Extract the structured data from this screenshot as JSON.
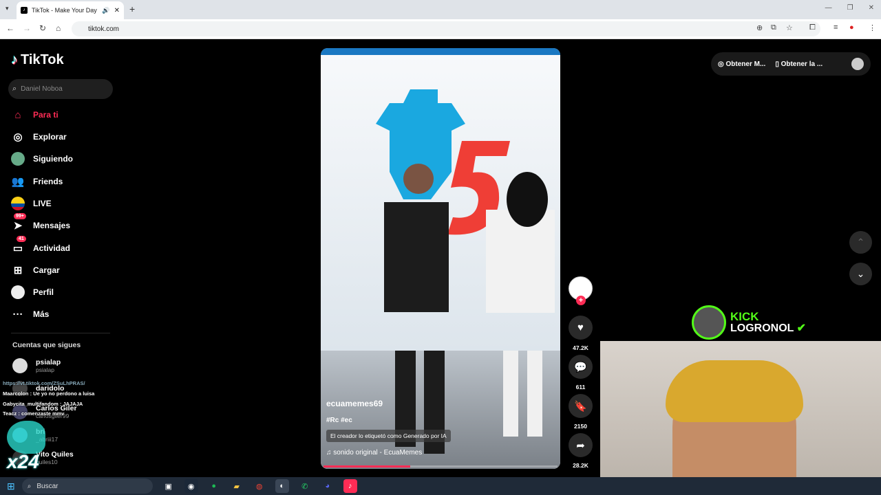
{
  "browser": {
    "tab_title": "TikTok - Make Your Day",
    "url": "tiktok.com"
  },
  "tiktok": {
    "logo": "TikTok",
    "search_placeholder": "Daniel Noboa",
    "nav": [
      {
        "label": "Para ti",
        "icon": "home-icon",
        "active": true
      },
      {
        "label": "Explorar",
        "icon": "compass-icon"
      },
      {
        "label": "Siguiendo",
        "icon": "avatar-icon"
      },
      {
        "label": "Friends",
        "icon": "people-icon"
      },
      {
        "label": "LIVE",
        "icon": "live-icon"
      },
      {
        "label": "Mensajes",
        "icon": "send-icon",
        "badge": "99+"
      },
      {
        "label": "Actividad",
        "icon": "inbox-icon",
        "badge": "41"
      },
      {
        "label": "Cargar",
        "icon": "plus-square-icon"
      },
      {
        "label": "Perfil",
        "icon": "profile-icon"
      },
      {
        "label": "Más",
        "icon": "more-icon"
      }
    ],
    "following_title": "Cuentas que sigues",
    "following": [
      {
        "name": "psialap",
        "user": "psialap"
      },
      {
        "name": "daridolo",
        "user": ""
      },
      {
        "name": "Carlos Giler",
        "user": "carlosgiler99"
      },
      {
        "name": "bri",
        "user": "_abriii17"
      },
      {
        "name": "Vito Quiles",
        "user": "quiles10"
      }
    ],
    "video": {
      "username": "ecuamemes69",
      "tags": "#Rc #ec",
      "ai_label": "El creador lo etiquetó como Generado por IA",
      "music": "sonido original - EcuaMemes",
      "progress": 0.37
    },
    "actions": {
      "likes": "47.2K",
      "comments": "611",
      "saves": "2150",
      "shares": "28.2K"
    },
    "top_right": {
      "btn1": "Obtener M...",
      "btn2": "Obtener la ..."
    }
  },
  "overlay": {
    "kick_label": "KICK",
    "streamer": "LOGRONOL",
    "chat": [
      "https://vt.tiktok.com/ZSuLhPRAS/",
      "Maarcolon : Ue yo no perdono a luisa",
      "Gabycita_multifandom : JAJAJA",
      "Teacz : comenzaste mmv"
    ],
    "badge": "x24"
  },
  "taskbar": {
    "search": "Buscar"
  }
}
